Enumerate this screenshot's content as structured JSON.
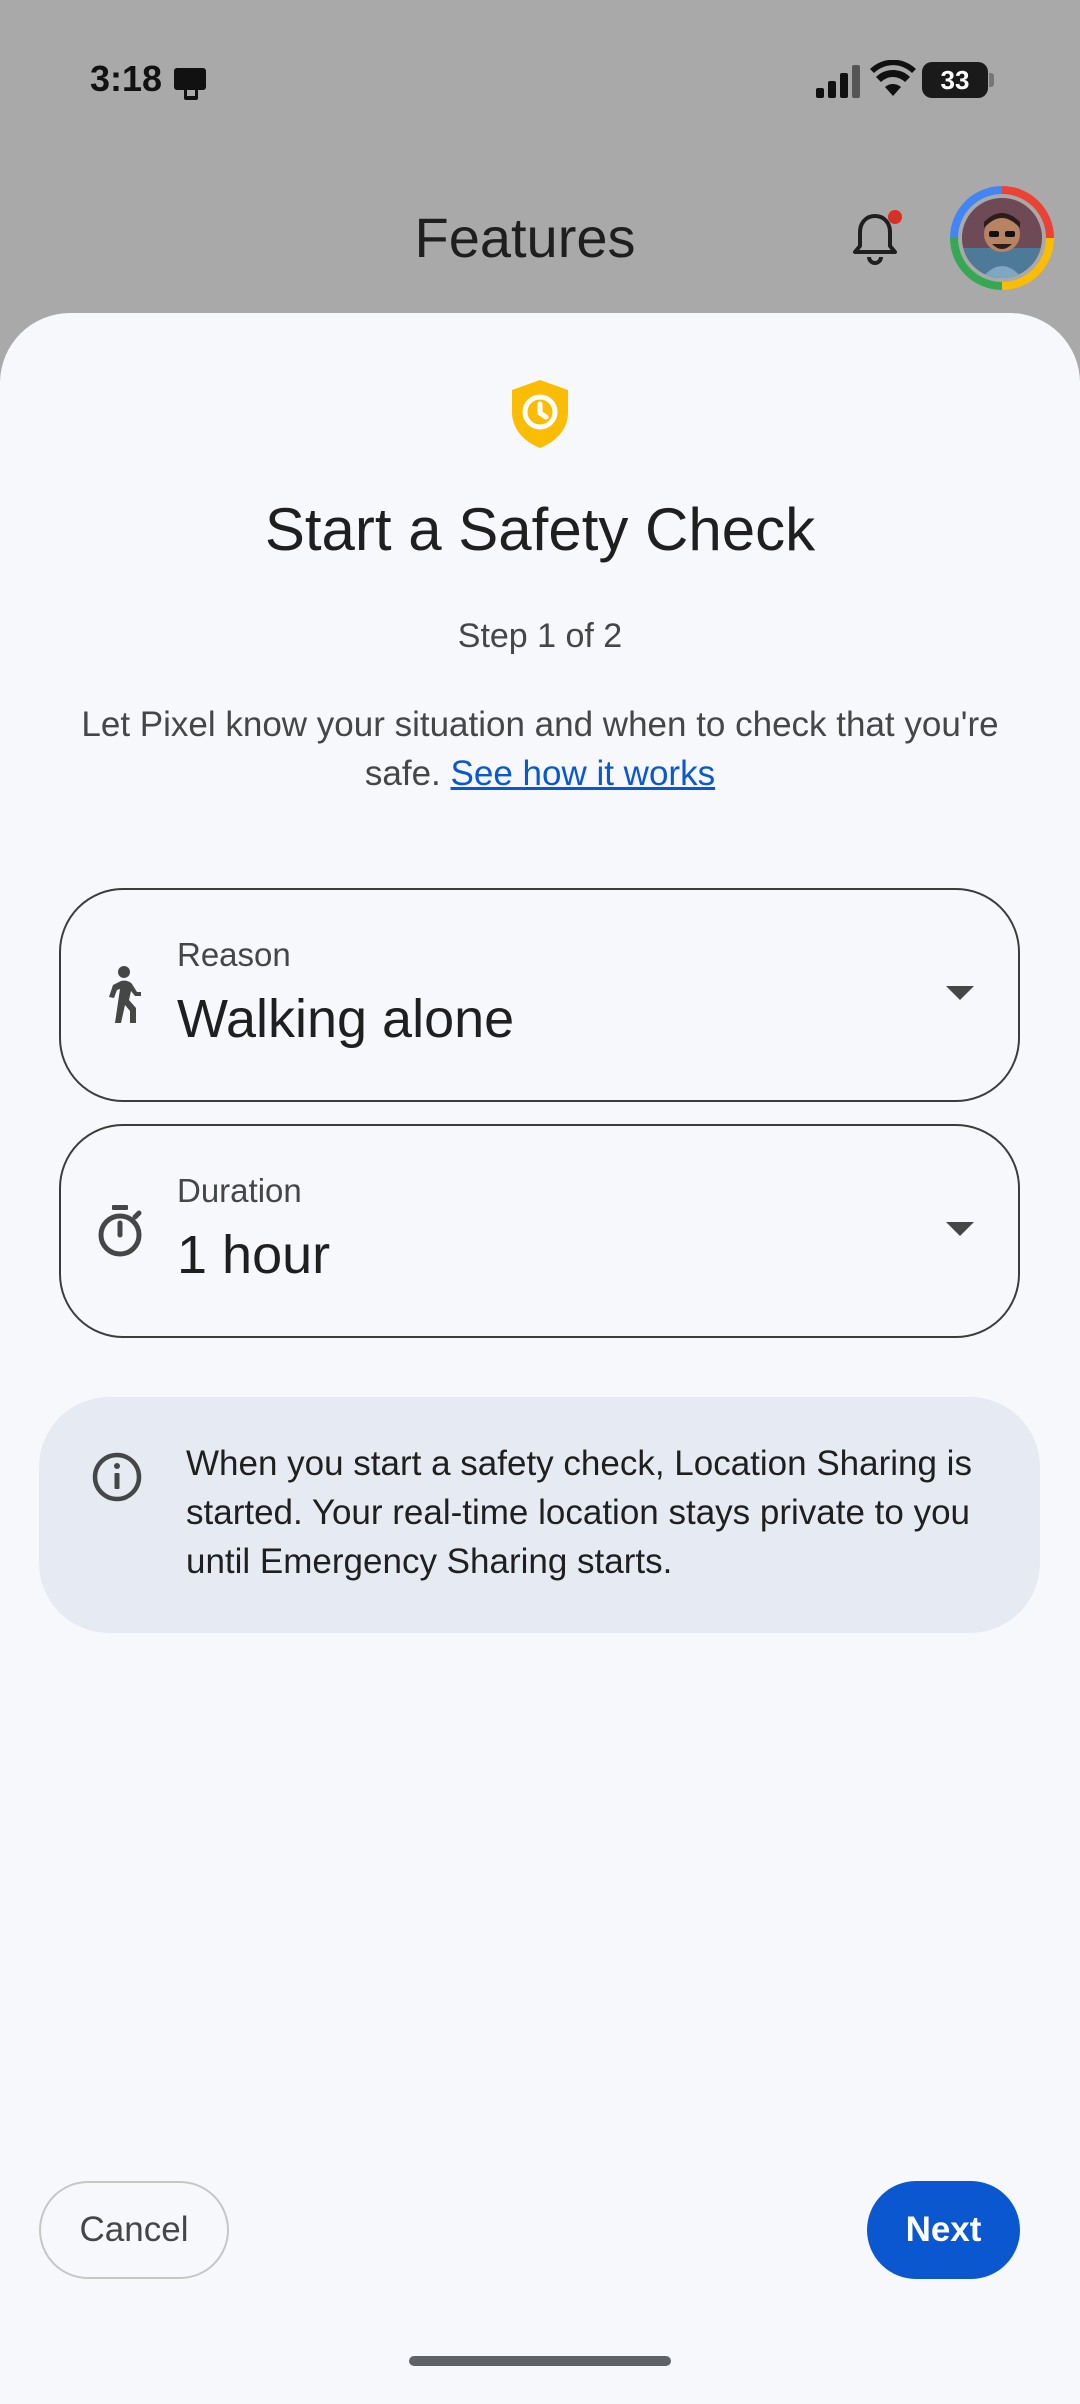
{
  "status_bar": {
    "time": "3:18",
    "battery": "33"
  },
  "app_header": {
    "title": "Features",
    "notification_dot_color": "#d93025"
  },
  "sheet": {
    "icon": "shield-clock-icon",
    "icon_color": "#fbbc04",
    "title": "Start a Safety Check",
    "step": "Step 1 of 2",
    "description": "Let Pixel know your situation and when to check that you're safe.",
    "link": "See how it works",
    "fields": [
      {
        "label": "Reason",
        "value": "Walking alone",
        "icon": "walking-person-icon"
      },
      {
        "label": "Duration",
        "value": "1 hour",
        "icon": "timer-icon"
      }
    ],
    "info": {
      "icon": "info-icon",
      "text": "When you start a safety check, Location Sharing is started. Your real-time location stays private to you until Emergency Sharing starts."
    },
    "buttons": {
      "cancel": "Cancel",
      "next": "Next"
    },
    "accent_color": "#0b57d0"
  }
}
